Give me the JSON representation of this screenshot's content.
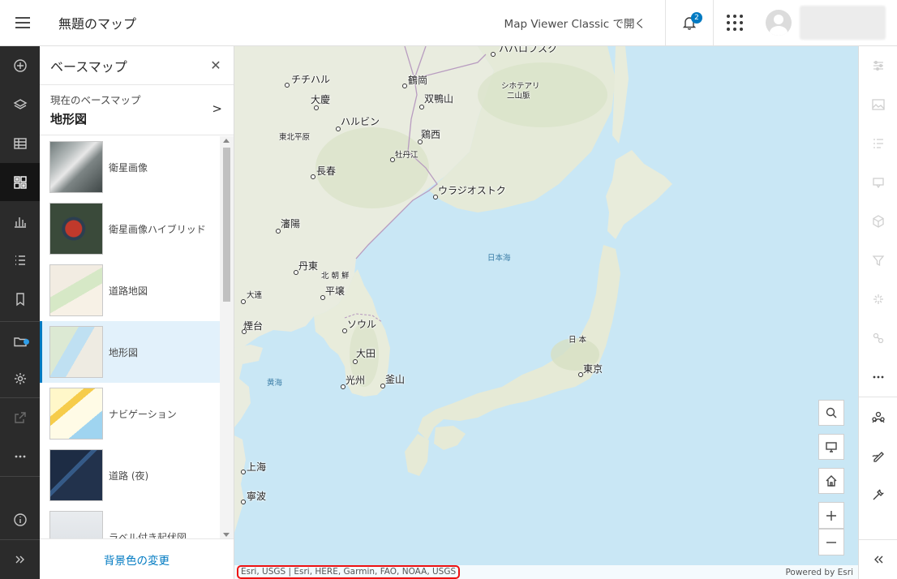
{
  "header": {
    "title": "無題のマップ",
    "classic_link": "Map Viewer Classic で開く",
    "notification_count": "2"
  },
  "panel": {
    "title": "ベースマップ",
    "current_label": "現在のベースマップ",
    "current_value": "地形図",
    "basemaps": [
      {
        "label": "衛星画像"
      },
      {
        "label": "衛星画像ハイブリッド"
      },
      {
        "label": "道路地図"
      },
      {
        "label": "地形図",
        "selected": true
      },
      {
        "label": "ナビゲーション"
      },
      {
        "label": "道路 (夜)"
      },
      {
        "label": "ラベル付き起伏図"
      }
    ],
    "footer_link": "背景色の変更"
  },
  "map": {
    "cities": [
      "チチハル",
      "鶴崗",
      "大慶",
      "双鴨山",
      "ハルビン",
      "鶏西",
      "東北平原",
      "牡丹江",
      "長春",
      "ウラジオストク",
      "瀋陽",
      "丹東",
      "北 朝 鮮",
      "平壌",
      "大連",
      "ソウル",
      "煙台",
      "大田",
      "光州",
      "釜山",
      "日 本",
      "東京",
      "上海",
      "寧波",
      "シホテアリ",
      "二山脈",
      "ハバロフスク"
    ],
    "seas": [
      "日本海",
      "黄海"
    ],
    "attribution": "Esri, USGS | Esri, HERE, Garmin, FAO, NOAA, USGS",
    "powered_by": "Powered by Esri"
  },
  "colors": {
    "accent": "#007ac2",
    "water": "#c9e7f5",
    "land": "#eef0e6",
    "left_toolbar": "#2b2b2b",
    "attribution_highlight": "#e11111"
  },
  "icons": {
    "left_toolbar": [
      "add-icon",
      "layers-icon",
      "table-icon",
      "basemap-icon",
      "chart-icon",
      "legend-icon",
      "bookmark-icon",
      "folder-icon",
      "settings-icon",
      "share-icon",
      "more-icon",
      "info-icon",
      "expand-icon"
    ],
    "right_toolbar": [
      "properties-icon",
      "styles-icon",
      "fields-icon",
      "pop-ups-icon",
      "cluster-icon",
      "filter-icon",
      "effects-icon",
      "labels-icon",
      "more-icon",
      "analysis-icon",
      "sketch-icon",
      "tools-icon",
      "collapse-icon"
    ],
    "map_controls": [
      "search-icon",
      "screen-icon",
      "home-icon",
      "zoom-in-icon",
      "zoom-out-icon"
    ]
  }
}
